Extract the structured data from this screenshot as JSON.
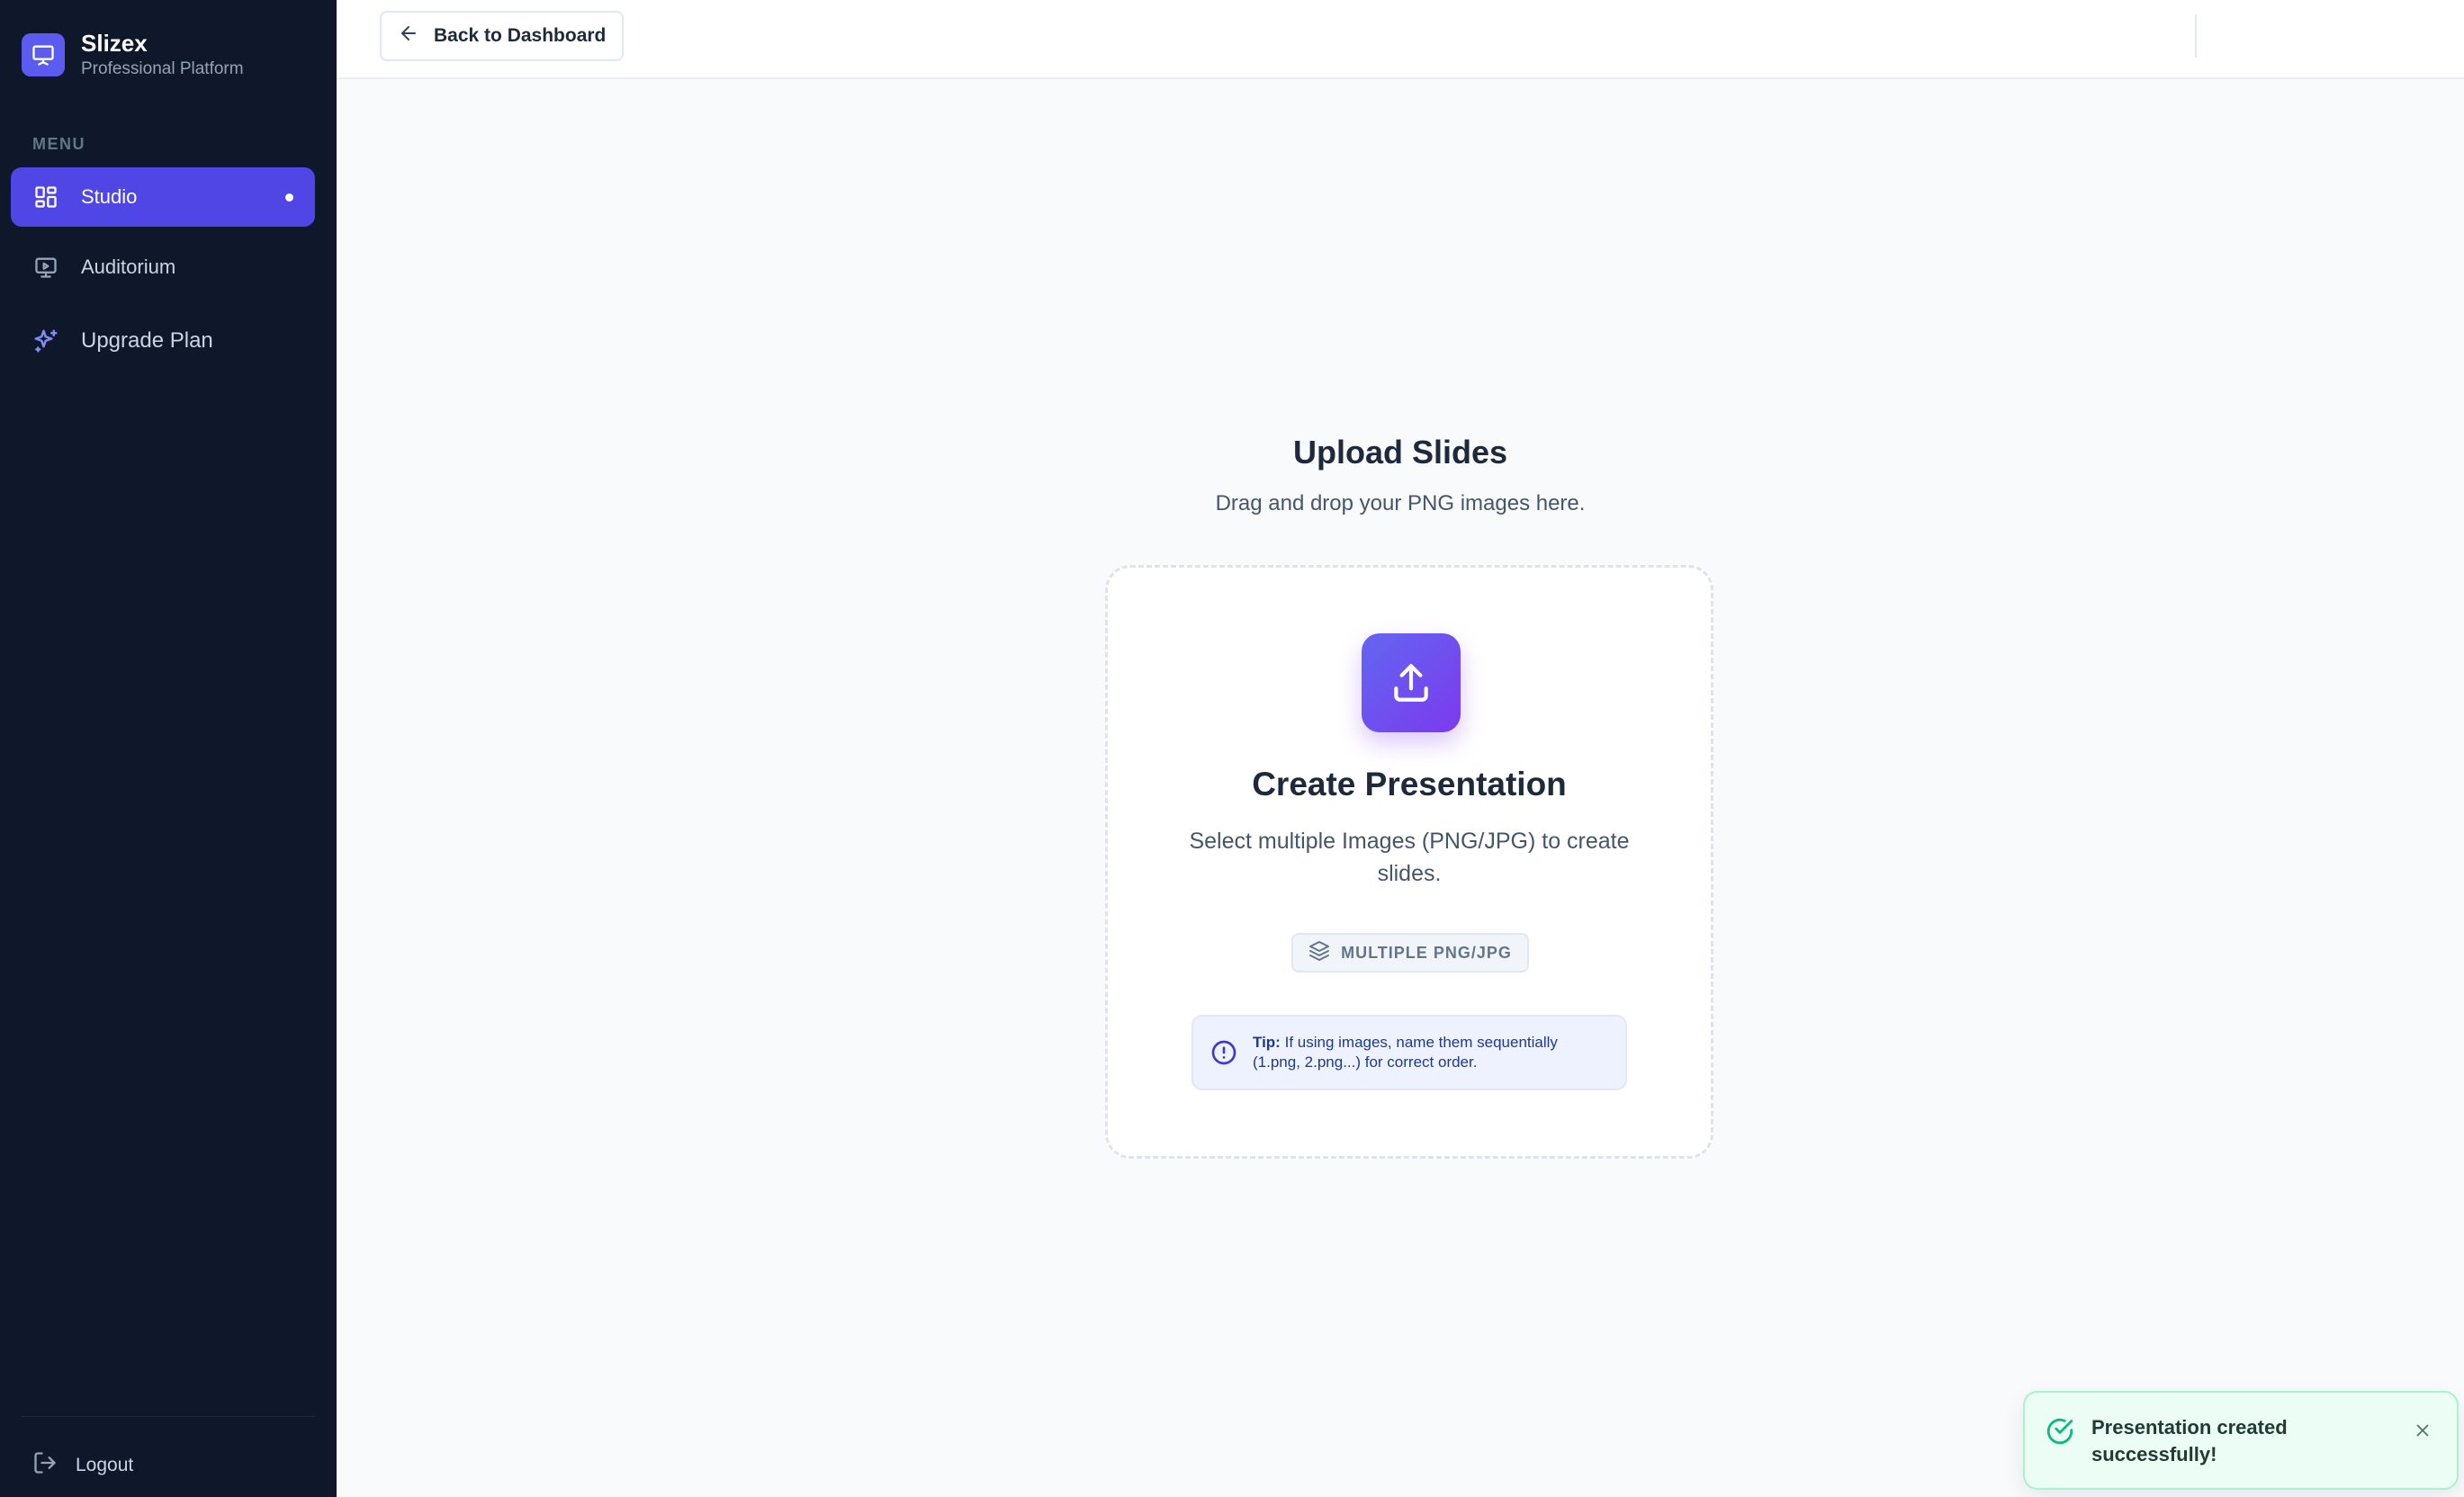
{
  "brand": {
    "name": "Slizex",
    "subtitle": "Professional Platform",
    "icon": "presentation-icon"
  },
  "sidebar": {
    "menu_label": "MENU",
    "items": [
      {
        "label": "Studio",
        "icon": "grid-icon",
        "active": true
      },
      {
        "label": "Auditorium",
        "icon": "monitor-play-icon",
        "active": false
      },
      {
        "label": "Upgrade Plan",
        "icon": "sparkles-icon",
        "active": false
      }
    ],
    "logout_label": "Logout"
  },
  "topbar": {
    "back_label": "Back to Dashboard"
  },
  "main": {
    "title": "Upload Slides",
    "subtitle": "Drag and drop your PNG images here.",
    "dropzone": {
      "title": "Create Presentation",
      "description": "Select multiple Images (PNG/JPG) to create slides.",
      "badge": "MULTIPLE PNG/JPG",
      "tip_label": "Tip:",
      "tip_text": "If using images, name them sequentially (1.png, 2.png...) for correct order."
    }
  },
  "toast": {
    "message": "Presentation created successfully!",
    "type": "success"
  },
  "colors": {
    "sidebar_bg": "#0f172a",
    "accent": "#4f46e5",
    "upload_gradient_start": "#6366f1",
    "upload_gradient_end": "#7c3aed",
    "toast_bg": "#ecfdf5",
    "success": "#10b981"
  }
}
